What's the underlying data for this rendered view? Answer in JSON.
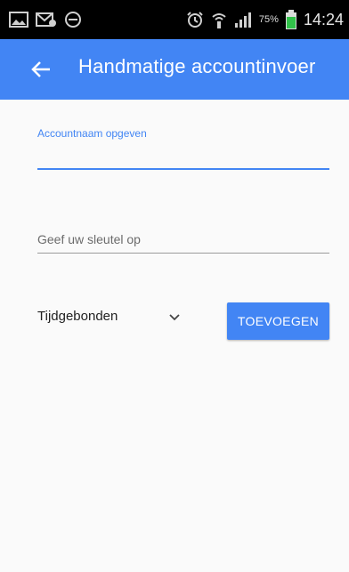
{
  "status_bar": {
    "time": "14:24",
    "battery_percent": "75%",
    "icons_left": [
      "image-icon",
      "mail-icon",
      "minus-circle-icon"
    ],
    "icons_right": [
      "alarm-icon",
      "wifi-icon",
      "signal-icon",
      "battery-icon"
    ]
  },
  "app_bar": {
    "title": "Handmatige accountinvoer",
    "background": "#4285f4",
    "back_icon": "arrow-left-icon"
  },
  "form": {
    "account_name": {
      "label": "Accountnaam opgeven",
      "value": "",
      "focused": true
    },
    "key": {
      "placeholder": "Geef uw sleutel op",
      "value": ""
    },
    "type_select": {
      "selected": "Tijdgebonden",
      "icon": "chevron-down-icon"
    },
    "add_button": {
      "label": "TOEVOEGEN"
    }
  },
  "colors": {
    "accent": "#4285f4",
    "status_bar": "#000000",
    "background": "#fafafa"
  }
}
